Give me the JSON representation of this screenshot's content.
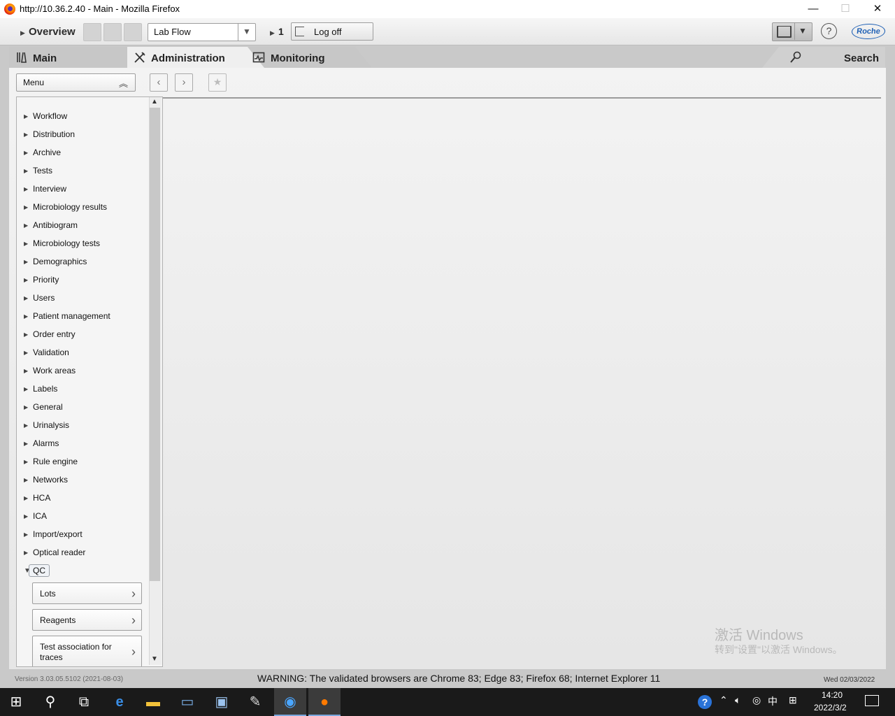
{
  "window": {
    "title": "http://10.36.2.40 - Main - Mozilla Firefox",
    "minimize": "—",
    "maximize": "☐",
    "close": "✕"
  },
  "toolbar": {
    "overview_label": "Overview",
    "workflow_value": "Lab Flow",
    "counter": "1",
    "logoff_label": "Log off",
    "help_glyph": "?",
    "brand": "Roche"
  },
  "tabs": {
    "main": "Main",
    "administration": "Administration",
    "monitoring": "Monitoring",
    "search": "Search"
  },
  "menu": {
    "button_label": "Menu",
    "items": [
      "Workflow",
      "Distribution",
      "Archive",
      "Tests",
      "Interview",
      "Microbiology results",
      "Antibiogram",
      "Microbiology tests",
      "Demographics",
      "Priority",
      "Users",
      "Patient management",
      "Order entry",
      "Validation",
      "Work areas",
      "Labels",
      "General",
      "Urinalysis",
      "Alarms",
      "Rule engine",
      "Networks",
      "HCA",
      "ICA",
      "Import/export",
      "Optical reader"
    ],
    "expanded_item": "QC",
    "sub_items": [
      "Lots",
      "Reagents",
      "Test association for traces"
    ]
  },
  "status": {
    "version": "Version 3.03.05.5102 (2021-08-03)",
    "warning": "WARNING: The validated browsers are Chrome 83; Edge 83; Firefox 68; Internet Explorer 11",
    "date": "Wed 02/03/2022"
  },
  "watermark": {
    "title": "激活 Windows",
    "subtitle": "转到\"设置\"以激活 Windows。"
  },
  "taskbar": {
    "time": "14:20",
    "date": "2022/3/2",
    "ime": "中",
    "icons": [
      "windows-start-icon",
      "search-icon",
      "task-view-icon",
      "edge-icon",
      "file-explorer-icon",
      "app-icon",
      "remote-desktop-icon",
      "paint-icon",
      "app-launcher-icon",
      "firefox-icon"
    ]
  },
  "colors": {
    "accent": "#1d5fb4",
    "taskbar": "#1a1a1a",
    "tab_active": "#efefef"
  }
}
